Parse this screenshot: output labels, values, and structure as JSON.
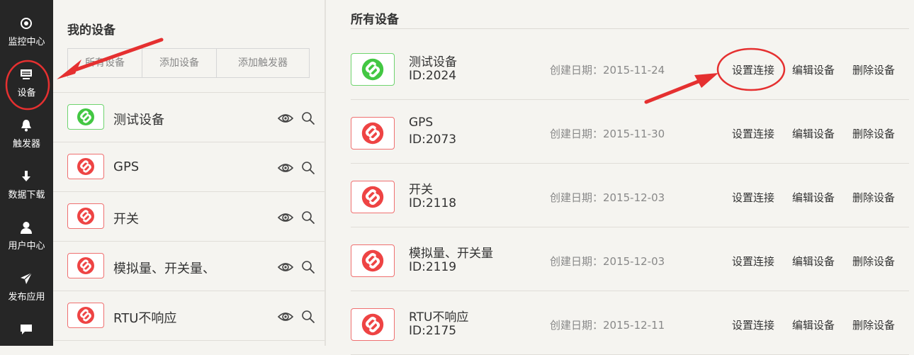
{
  "sidebar": {
    "items": [
      {
        "label": "监控中心",
        "icon": "target-icon"
      },
      {
        "label": "设备",
        "icon": "monitor-icon"
      },
      {
        "label": "触发器",
        "icon": "bell-icon"
      },
      {
        "label": "数据下载",
        "icon": "download-arrow-icon"
      },
      {
        "label": "用户中心",
        "icon": "user-icon"
      },
      {
        "label": "发布应用",
        "icon": "paper-plane-icon"
      },
      {
        "label": "",
        "icon": "chat-bubble-icon"
      }
    ]
  },
  "my_devices": {
    "title": "我的设备",
    "tabs": [
      "所有设备",
      "添加设备",
      "添加触发器"
    ],
    "list": [
      {
        "name": "测试设备",
        "status": "online"
      },
      {
        "name": "GPS",
        "status": "offline"
      },
      {
        "name": "开关",
        "status": "offline"
      },
      {
        "name": "模拟量、开关量、",
        "status": "offline"
      },
      {
        "name": "RTU不响应",
        "status": "offline"
      }
    ]
  },
  "all_devices": {
    "title": "所有设备",
    "rows": [
      {
        "name": "测试设备",
        "id": "ID:2024",
        "date": "创建日期：2015-11-24",
        "status": "online"
      },
      {
        "name": "GPS",
        "id": "ID:2073",
        "date": "创建日期：2015-11-30",
        "status": "offline"
      },
      {
        "name": "开关",
        "id": "ID:2118",
        "date": "创建日期：2015-12-03",
        "status": "offline"
      },
      {
        "name": "模拟量、开关量",
        "id": "ID:2119",
        "date": "创建日期：2015-12-03",
        "status": "offline"
      },
      {
        "name": "RTU不响应",
        "id": "ID:2175",
        "date": "创建日期：2015-12-11",
        "status": "offline"
      }
    ],
    "actions": [
      "设置连接",
      "编辑设备",
      "删除设备"
    ]
  },
  "colors": {
    "sidebar_bg": "#262626",
    "online": "#43c743",
    "offline": "#ee4444",
    "annotation": "#e53030"
  }
}
